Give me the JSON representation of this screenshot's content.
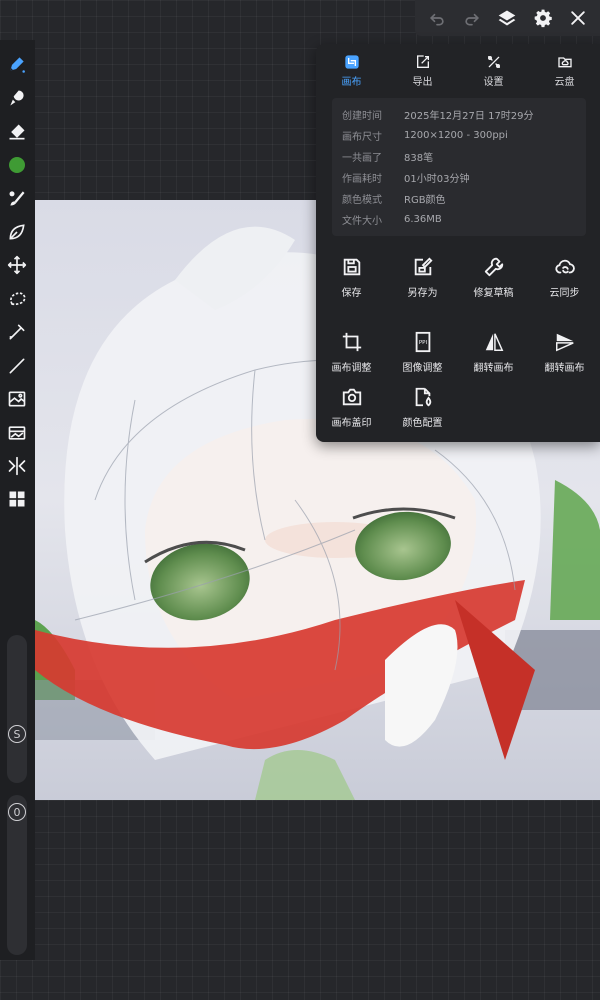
{
  "app": {
    "accent_color": "#4aa3ff",
    "brush_color": "#3f9b34"
  },
  "topbar": {
    "icons": [
      "undo-icon",
      "redo-icon",
      "layers-icon",
      "gear-icon",
      "close-icon"
    ]
  },
  "rail": {
    "tools": [
      "pen-icon",
      "smudge-icon",
      "eraser-icon",
      "color-dot",
      "brush-icon",
      "leaf-icon",
      "move-icon",
      "lasso-icon",
      "eyedropper-icon",
      "line-icon",
      "image-icon",
      "gallery-icon",
      "symmetry-icon",
      "grid-icon"
    ],
    "size_label": "S",
    "opacity_label": "0"
  },
  "panel": {
    "tabs": [
      {
        "label": "画布",
        "icon": "canvas-icon",
        "active": true
      },
      {
        "label": "导出",
        "icon": "export-icon",
        "active": false
      },
      {
        "label": "设置",
        "icon": "tools-icon",
        "active": false
      },
      {
        "label": "云盘",
        "icon": "cloud-folder-icon",
        "active": false
      }
    ],
    "info": [
      {
        "key": "创建时间",
        "value": "2025年12月27日 17时29分"
      },
      {
        "key": "画布尺寸",
        "value": "1200×1200 - 300ppi"
      },
      {
        "key": "一共画了",
        "value": "838笔"
      },
      {
        "key": "作画耗时",
        "value": "01小时03分钟"
      },
      {
        "key": "颜色模式",
        "value": "RGB颜色"
      },
      {
        "key": "文件大小",
        "value": "6.36MB"
      }
    ],
    "actions_row1": [
      {
        "label": "保存",
        "icon": "save-icon"
      },
      {
        "label": "另存为",
        "icon": "save-as-icon"
      },
      {
        "label": "修复草稿",
        "icon": "wrench-icon"
      },
      {
        "label": "云同步",
        "icon": "cloud-sync-icon"
      }
    ],
    "actions_row2": [
      {
        "label": "画布调整",
        "icon": "crop-icon"
      },
      {
        "label": "图像调整",
        "icon": "ppi-icon"
      },
      {
        "label": "翻转画布",
        "icon": "flip-horizontal-icon"
      },
      {
        "label": "翻转画布",
        "icon": "flip-vertical-icon"
      }
    ],
    "actions_row3": [
      {
        "label": "画布盖印",
        "icon": "camera-icon"
      },
      {
        "label": "颜色配置",
        "icon": "color-profile-icon"
      }
    ]
  }
}
